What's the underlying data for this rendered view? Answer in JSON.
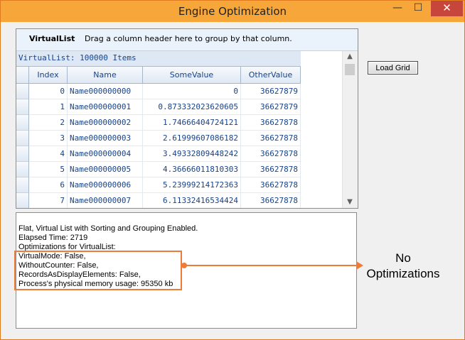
{
  "window": {
    "title": "Engine Optimization",
    "min_glyph": "—",
    "max_glyph": "☐",
    "close_glyph": "✕",
    "frame_color": "#f7a63a",
    "close_color": "#c7463b"
  },
  "grid": {
    "group_title": "VirtualList",
    "group_hint": "Drag a column header here to group by that column.",
    "caption": "VirtualList: 100000 Items",
    "columns": [
      "Index",
      "Name",
      "SomeValue",
      "OtherValue"
    ],
    "rows": [
      {
        "index": "0",
        "name": "Name000000000",
        "some": "0",
        "other": "36627879"
      },
      {
        "index": "1",
        "name": "Name000000001",
        "some": "0.873332023620605",
        "other": "36627879"
      },
      {
        "index": "2",
        "name": "Name000000002",
        "some": "1.74666404724121",
        "other": "36627878"
      },
      {
        "index": "3",
        "name": "Name000000003",
        "some": "2.61999607086182",
        "other": "36627878"
      },
      {
        "index": "4",
        "name": "Name000000004",
        "some": "3.49332809448242",
        "other": "36627878"
      },
      {
        "index": "5",
        "name": "Name000000005",
        "some": "4.36666011810303",
        "other": "36627878"
      },
      {
        "index": "6",
        "name": "Name000000006",
        "some": "5.23999214172363",
        "other": "36627878"
      },
      {
        "index": "7",
        "name": "Name000000007",
        "some": "6.11332416534424",
        "other": "36627878"
      }
    ],
    "scroll_up": "▲",
    "scroll_down": "▼"
  },
  "load_button": "Load Grid",
  "output": {
    "lines": [
      "Flat, Virtual List with Sorting and Grouping Enabled.",
      "Elapsed Time: 2719",
      "Optimizations for VirtualList:",
      "VirtualMode: False,",
      "WithoutCounter: False,",
      "RecordsAsDisplayElements: False,",
      "Process's physical memory usage: 95350 kb"
    ]
  },
  "annotation": {
    "label_line1": "No",
    "label_line2": "Optimizations",
    "color": "#ef7b3a"
  }
}
